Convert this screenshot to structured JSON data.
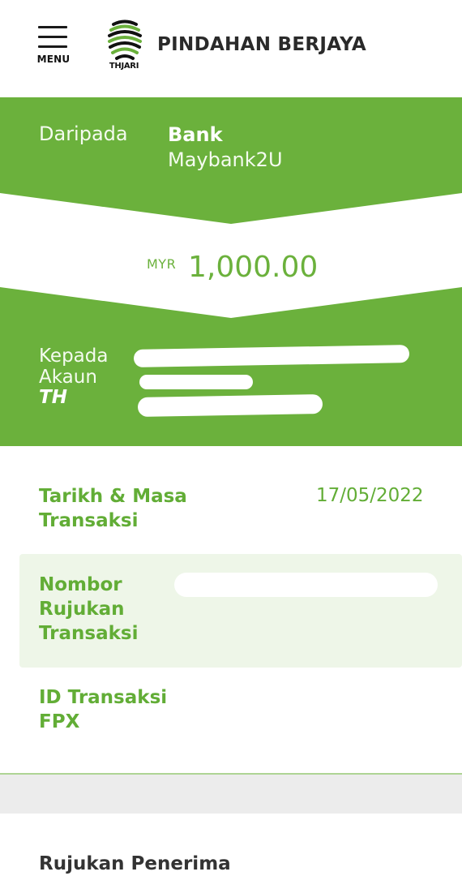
{
  "header": {
    "menu_label": "MENU",
    "logo_text": "THJARI",
    "title": "PINDAHAN BERJAYA"
  },
  "from": {
    "label": "Daripada",
    "bank_title": "Bank",
    "bank_name": "Maybank2U"
  },
  "amount": {
    "currency": "MYR",
    "value": "1,000.00"
  },
  "to": {
    "label_line1": "Kepada",
    "label_line2": "Akaun",
    "label_th": "TH"
  },
  "details": {
    "date_label": "Tarikh & Masa Transaksi",
    "date_value": "17/05/2022",
    "reference_label": "Nombor Rujukan Transaksi",
    "fpx_label": "ID Transaksi FPX"
  },
  "footer": {
    "recipient_reference_label": "Rujukan Penerima"
  },
  "colors": {
    "brand_green": "#6bb13c",
    "label_green": "#62ad36",
    "highlight_bg": "#eef6e8"
  },
  "icons": {
    "menu": "hamburger-icon",
    "logo": "thjari-logo"
  }
}
